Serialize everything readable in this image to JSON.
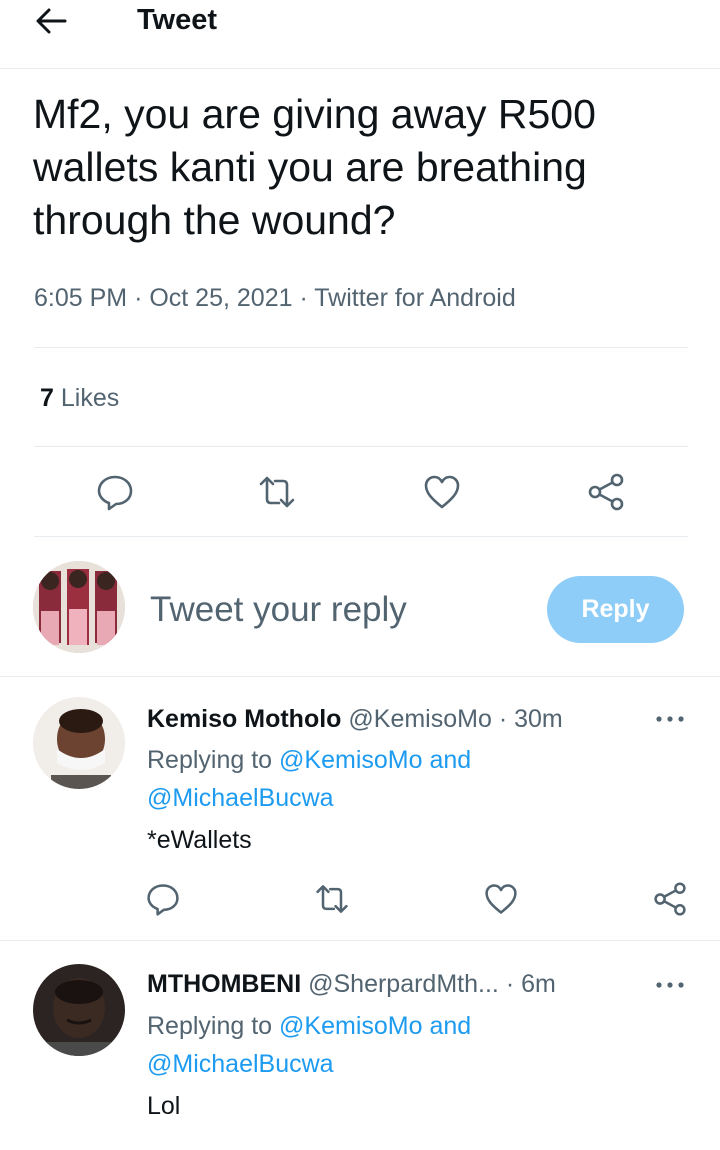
{
  "header": {
    "title": "Tweet",
    "back_icon": "arrow-left-icon"
  },
  "tweet": {
    "text": "Mf2, you are giving away R500 wallets kanti you are breathing through the wound?",
    "time": "6:05 PM",
    "sep1": "·",
    "date": "Oct 25, 2021",
    "sep2": "·",
    "source": "Twitter for Android",
    "likes_count": "7",
    "likes_label": "Likes"
  },
  "composer": {
    "placeholder": "Tweet your reply",
    "reply_button": "Reply"
  },
  "replies": [
    {
      "name": "Kemiso Motholo",
      "handle": "@KemisoMo",
      "sep": "·",
      "time": "30m",
      "replying_prefix": "Replying to",
      "mention1": "@KemisoMo",
      "and": "and",
      "mention2": "@MichaelBucwa",
      "text": "*eWallets"
    },
    {
      "name": "MTHOMBENI",
      "handle": "@SherpardMth...",
      "sep": "·",
      "time": "6m",
      "replying_prefix": "Replying to",
      "mention1": "@KemisoMo",
      "and": "and",
      "mention2": "@MichaelBucwa",
      "text": "Lol"
    }
  ],
  "colors": {
    "accent": "#1d9bf0",
    "reply_button": "#8ecdf8",
    "secondary_text": "#536471"
  }
}
